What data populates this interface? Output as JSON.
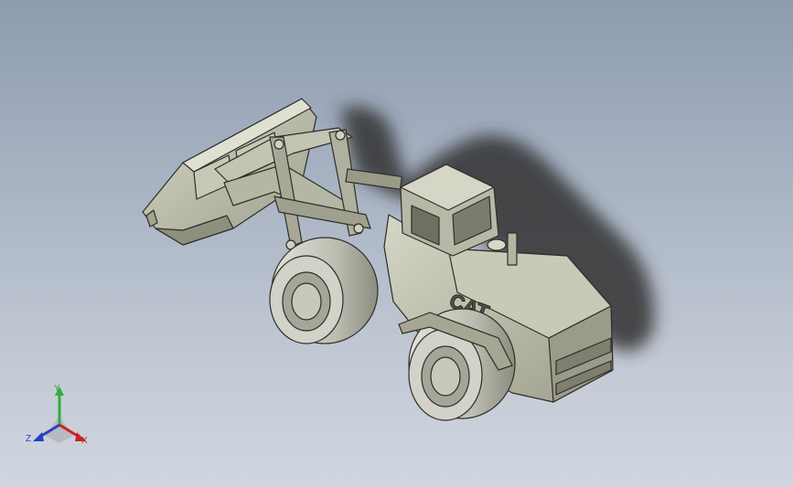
{
  "model": {
    "brand_label": "CAT",
    "colors": {
      "background_top": "#8e9cb0",
      "background_bottom": "#d0d6df",
      "body": "#bdbda9",
      "shadow": "#3a3a3a",
      "tire": "#c9c9bf",
      "edge": "#2e2e2a"
    }
  },
  "triad": {
    "x_label": "X",
    "y_label": "Y",
    "z_label": "Z",
    "x_color": "#c92323",
    "y_color": "#2fae3b",
    "z_color": "#2b3fc4"
  }
}
